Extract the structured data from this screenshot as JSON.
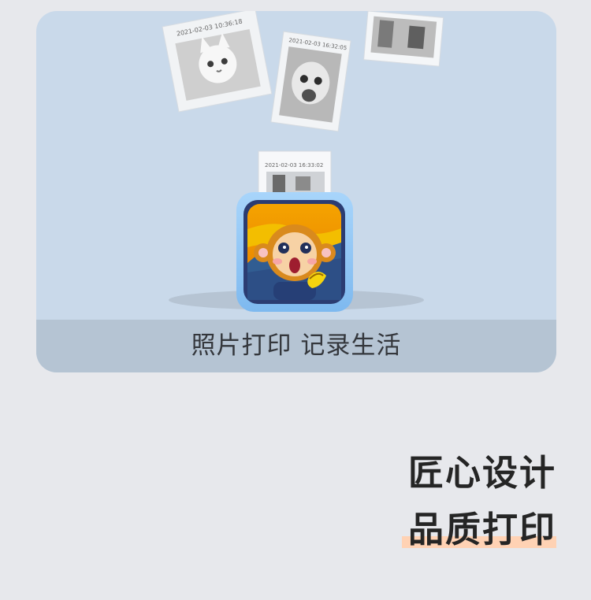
{
  "banner": {
    "caption": "照片打印 记录生活",
    "photos": {
      "photo_1_timestamp": "2021-02-03 10:36:18",
      "photo_2_timestamp": "2021-02-03 16:32:05",
      "photo_printing_timestamp": "2021-02-03 16:33:02"
    }
  },
  "headlines": {
    "line_1": "匠心设计",
    "line_2": "品质打印"
  },
  "colors": {
    "page_background": "#e7e8ec",
    "card_background": "#c9d9ea",
    "caption_bar": "#b5c4d3",
    "printer_body": "#8bc4f5",
    "highlight": "#ffd2b4"
  }
}
